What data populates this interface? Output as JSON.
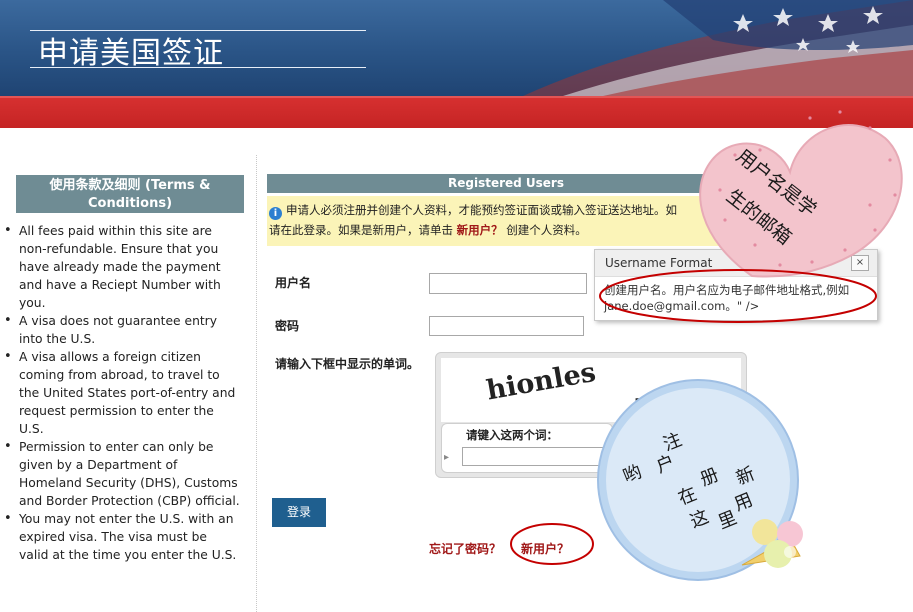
{
  "header": {
    "title": "申请美国签证"
  },
  "terms": {
    "heading": "使用条款及细则 (Terms & Conditions)",
    "items": [
      "All fees paid within this site are non-refundable. Ensure that you have already made the payment and have a Reciept Number with you.",
      "A visa does not guarantee entry into the U.S.",
      "A visa allows a foreign citizen coming from abroad, to travel to the United States port-of-entry and request permission to enter the U.S.",
      "Permission to enter can only be given by a Department of Homeland Security (DHS), Customs and Border Protection (CBP) official.",
      "You may not enter the U.S. with an expired visa. The visa must be valid at the time you enter the U.S."
    ]
  },
  "registered": {
    "heading": "Registered Users",
    "notice_line1": "申请人必须注册并创建个人资料，才能预约签证面谈或输入签证送达地址。如",
    "notice_line2_a": "请在此登录。如果是新用户，请单击 ",
    "notice_link": "新用户？",
    "notice_line2_b": " 创建个人资料。"
  },
  "form": {
    "username_label": "用户名",
    "username_value": "",
    "password_label": "密码",
    "password_value": "",
    "captcha_label": "请输入下框中显示的单词。",
    "captcha_word1": "hionles",
    "captcha_word2": "time",
    "captcha_prompt": "请键入这两个词：",
    "captcha_value": "",
    "login_button": "登录",
    "forgot_link": "忘记了密码？",
    "new_user_link": "新用户？"
  },
  "tooltip": {
    "title": "Username Format",
    "close": "×",
    "body": "创建用户名。用户名应为电子邮件地址格式,例如jane.doe@gmail.com。\" />"
  },
  "annotations": {
    "heart_text_1": "用户名是学",
    "heart_text_2": "生的邮箱",
    "circle_text": [
      "注",
      "册",
      "新",
      "用",
      "户",
      "在",
      "这",
      "里",
      "哟"
    ]
  },
  "colors": {
    "header_blue": "#2a5486",
    "red_bar": "#c52424",
    "section_head": "#6f8c94",
    "notice_bg": "#fbf4b8",
    "link_red": "#a01818",
    "button_blue": "#1f5f8f",
    "heart_pink": "#f3c4cc",
    "circle_blue": "#b8d3ef"
  }
}
